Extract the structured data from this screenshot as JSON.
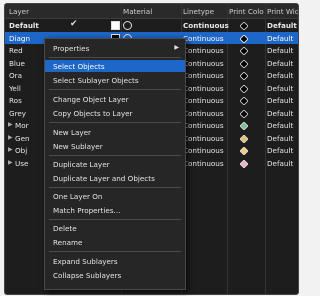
{
  "header": {
    "layer": "Layer",
    "material": "Material",
    "linetype": "Linetype",
    "print_color": "Print Colo",
    "print_width": "Print Wid"
  },
  "rows": [
    {
      "name": "Default",
      "linetype": "Continuous",
      "print_width": "Default",
      "swatch": "#ffffff"
    },
    {
      "name": "Diagn",
      "linetype": "Continuous",
      "print_width": "Default",
      "swatch": "#000000"
    },
    {
      "name": "Red",
      "linetype": "Continuous",
      "print_width": "Default",
      "swatch": "#000000"
    },
    {
      "name": "Blue",
      "linetype": "Continuous",
      "print_width": "Default",
      "swatch": "#000000"
    },
    {
      "name": "Ora",
      "linetype": "Continuous",
      "print_width": "Default",
      "swatch": "#000000"
    },
    {
      "name": "Yell",
      "linetype": "Continuous",
      "print_width": "Default",
      "swatch": "#000000"
    },
    {
      "name": "Ros",
      "linetype": "Continuous",
      "print_width": "Default",
      "swatch": "#000000"
    },
    {
      "name": "Grey",
      "linetype": "Continuous",
      "print_width": "Default",
      "swatch": "#000000"
    },
    {
      "name": "Mor",
      "linetype": "Continuous",
      "print_width": "Default",
      "swatch": "#7fbf9f"
    },
    {
      "name": "Gen",
      "linetype": "Continuous",
      "print_width": "Default",
      "swatch": "#e0c070"
    },
    {
      "name": "Obj",
      "linetype": "Continuous",
      "print_width": "Default",
      "swatch": "#f0d080"
    },
    {
      "name": "Use",
      "linetype": "Continuous",
      "print_width": "Default",
      "swatch": "#f0b0c8"
    }
  ],
  "menu": {
    "properties": "Properties",
    "select_objects": "Select Objects",
    "select_sublayer_objects": "Select Sublayer Objects",
    "change_object_layer": "Change Object Layer",
    "copy_objects_to_layer": "Copy Objects to Layer",
    "new_layer": "New Layer",
    "new_sublayer": "New Sublayer",
    "duplicate_layer": "Duplicate Layer",
    "duplicate_layer_and_objects": "Duplicate Layer and Objects",
    "one_layer_on": "One Layer On",
    "match_properties": "Match Properties...",
    "delete": "Delete",
    "rename": "Rename",
    "expand_sublayers": "Expand Sublayers",
    "collapse_sublayers": "Collapse Sublayers"
  },
  "colors": {
    "selection": "#1e66c8",
    "background": "#1d1d1d"
  }
}
